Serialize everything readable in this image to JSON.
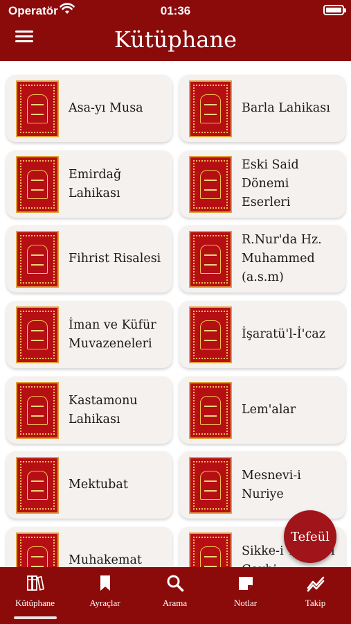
{
  "status_bar": {
    "carrier": "Operatör",
    "time": "01:36"
  },
  "header": {
    "title": "Kütüphane"
  },
  "books": [
    {
      "title": "Asa-yı Musa"
    },
    {
      "title": "Barla Lahikası"
    },
    {
      "title": "Emirdağ Lahikası"
    },
    {
      "title": "Eski Said Dönemi Eserleri"
    },
    {
      "title": "Fihrist Risalesi"
    },
    {
      "title": "R.Nur'da Hz. Muhammed (a.s.m)"
    },
    {
      "title": "İman ve Küfür Muvazeneleri"
    },
    {
      "title": "İşaratü'l-İ'caz"
    },
    {
      "title": "Kastamonu Lahikası"
    },
    {
      "title": "Lem'alar"
    },
    {
      "title": "Mektubat"
    },
    {
      "title": "Mesnevi-i Nuriye"
    },
    {
      "title": "Muhakemat"
    },
    {
      "title": "Sikke-i Tasdik-i Gaybi"
    }
  ],
  "fab": {
    "label": "Tefeül"
  },
  "tabs": [
    {
      "label": "Kütüphane",
      "icon": "library-icon"
    },
    {
      "label": "Ayraçlar",
      "icon": "bookmark-icon"
    },
    {
      "label": "Arama",
      "icon": "search-icon"
    },
    {
      "label": "Notlar",
      "icon": "notes-icon"
    },
    {
      "label": "Takip",
      "icon": "chart-icon"
    }
  ],
  "colors": {
    "primary": "#8b0b0b",
    "card": "#f4f1ef",
    "fab": "#a0141a",
    "cover": "#b50f14",
    "cover_gold": "#e0a13a"
  }
}
